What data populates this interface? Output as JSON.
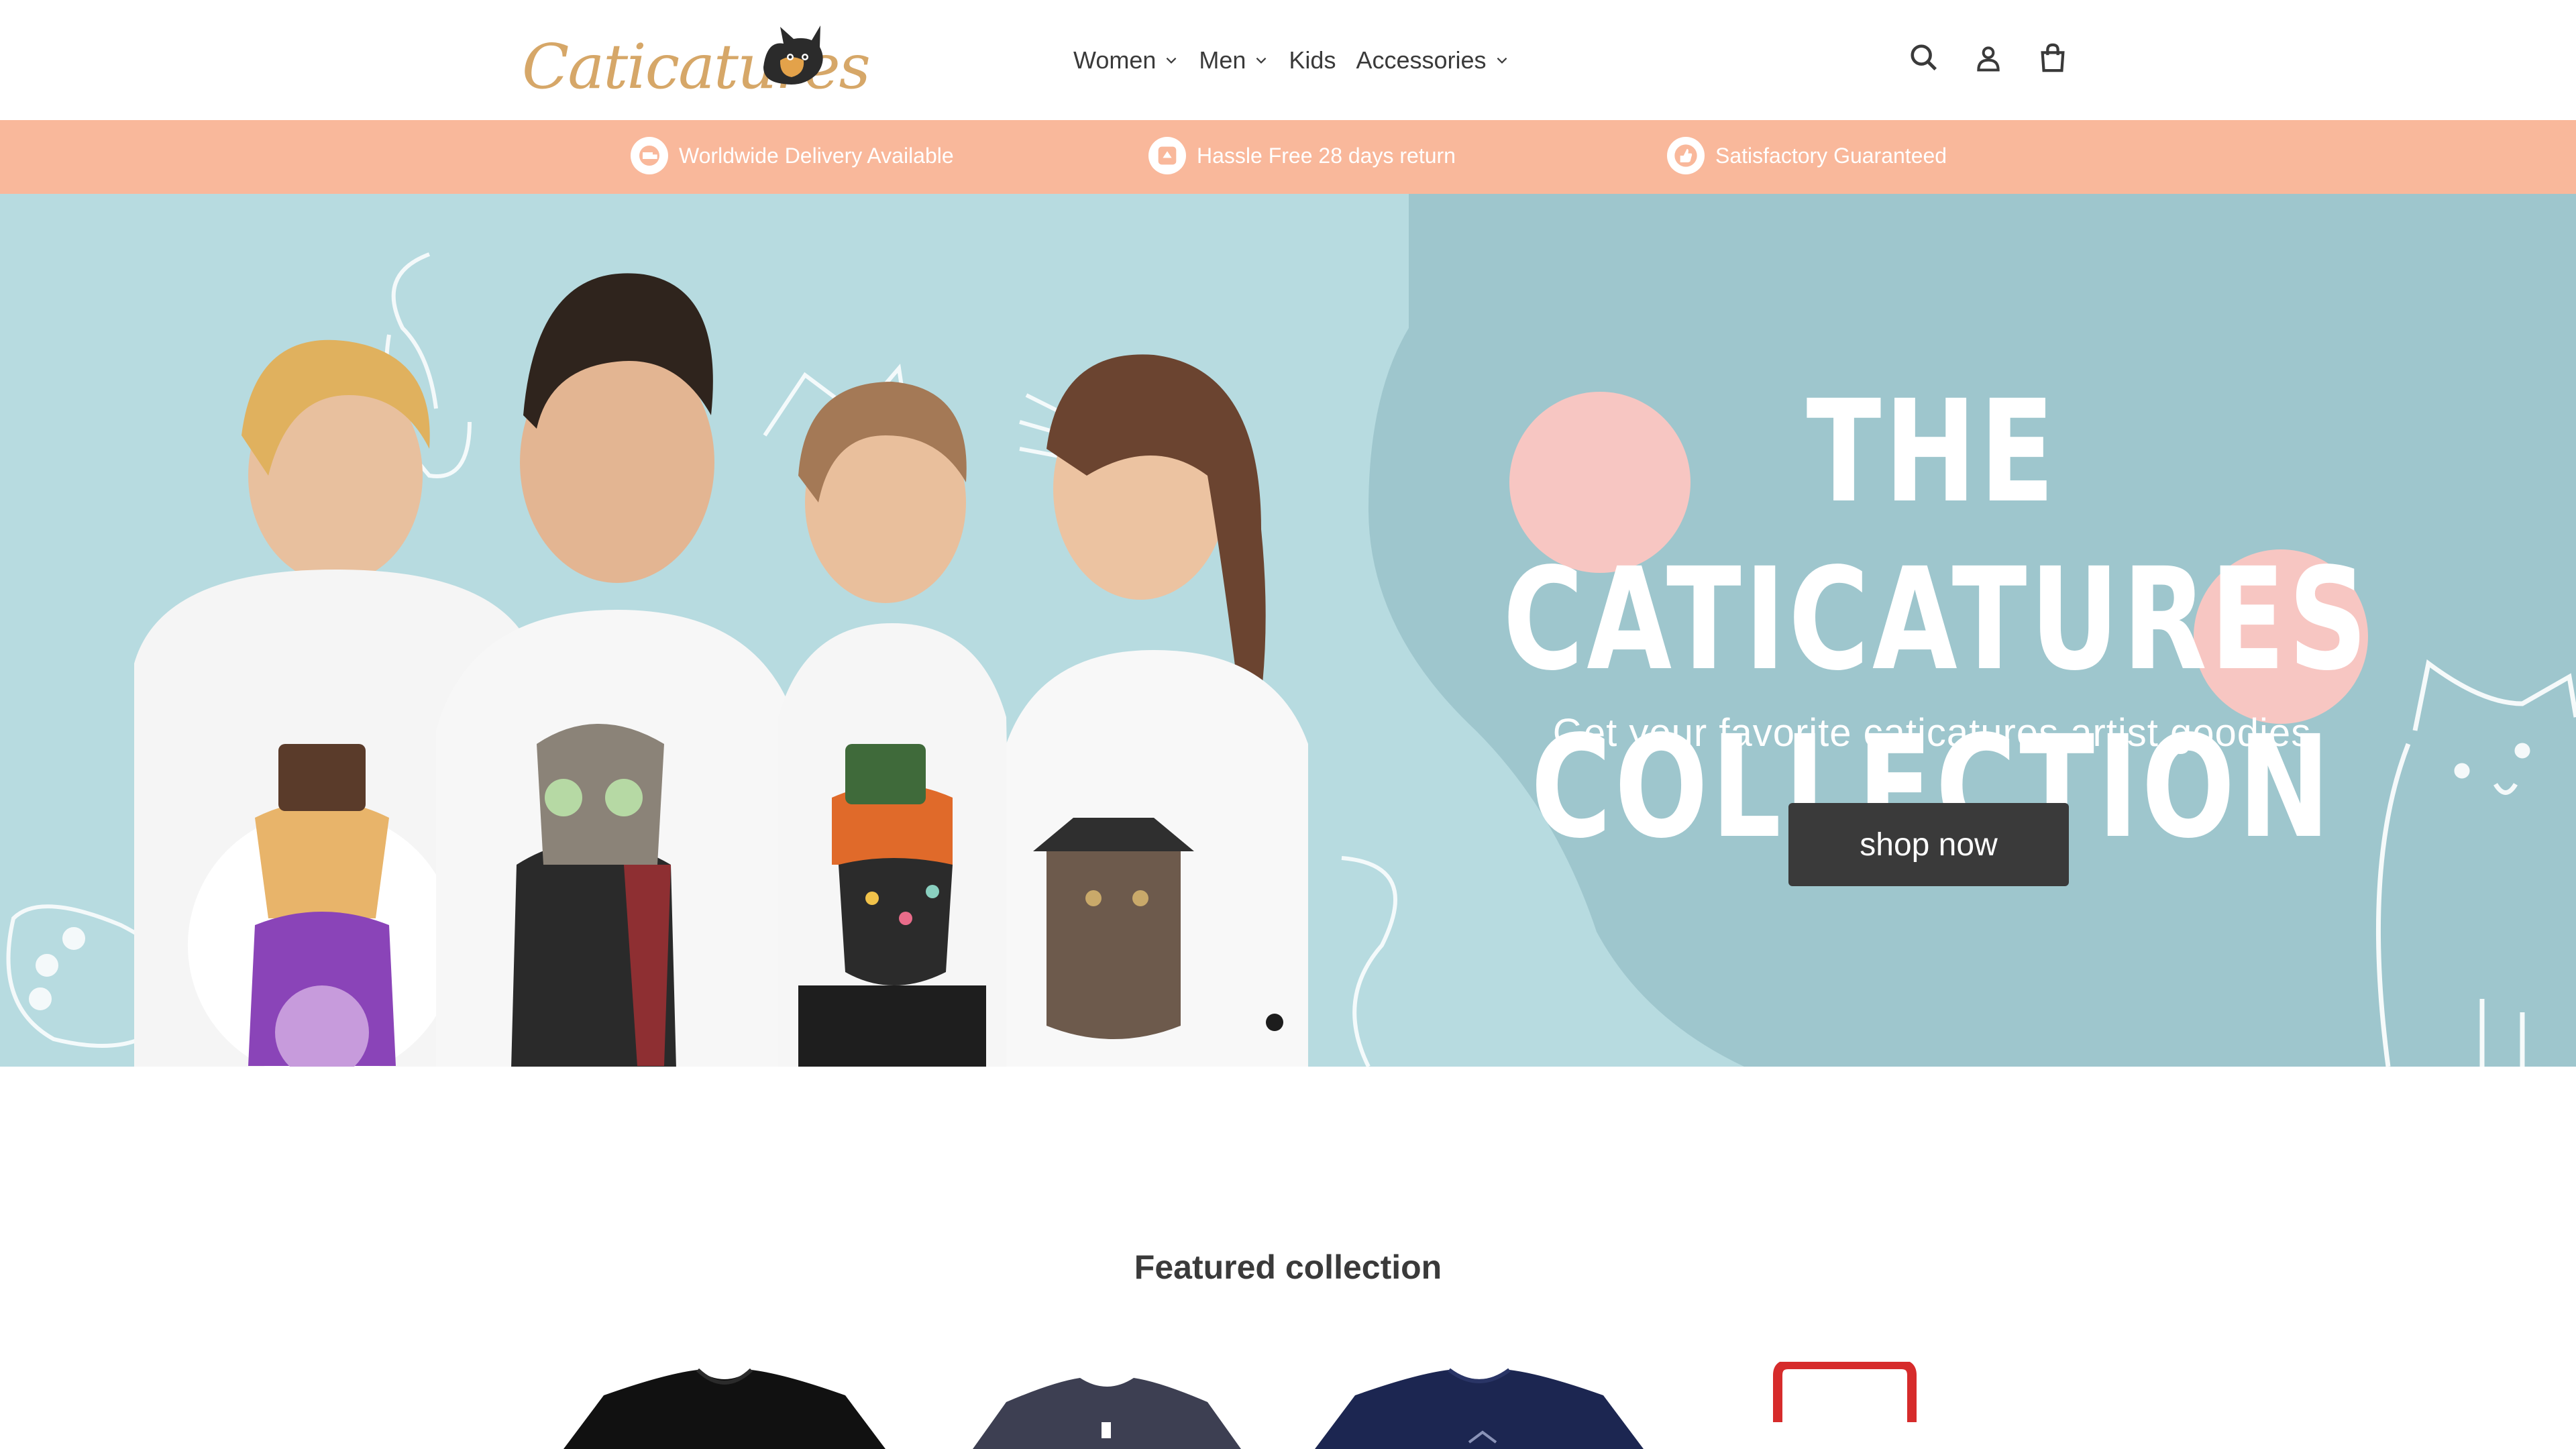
{
  "brand": {
    "name": "Caticatures",
    "accent_color": "#d6a768"
  },
  "nav": {
    "items": [
      {
        "label": "Women",
        "has_dropdown": true
      },
      {
        "label": "Men",
        "has_dropdown": true
      },
      {
        "label": "Kids",
        "has_dropdown": false
      },
      {
        "label": "Accessories",
        "has_dropdown": true
      }
    ]
  },
  "header_icons": [
    "search-icon",
    "account-icon",
    "cart-icon"
  ],
  "announcement": {
    "background": "#f9b89b",
    "items": [
      {
        "icon": "delivery-icon",
        "text": "Worldwide Delivery Available"
      },
      {
        "icon": "return-icon",
        "text": "Hassle Free 28 days return"
      },
      {
        "icon": "thumbs-up-icon",
        "text": "Satisfactory Guaranteed"
      }
    ]
  },
  "hero": {
    "title_line1": "THE CATICATURES",
    "title_line2": "COLLECTION",
    "subtitle": "Get your favorite caticatures artist goodies",
    "button_label": "shop now",
    "background": "#b7dbe0",
    "slide_count": 1,
    "active_slide": 1
  },
  "featured": {
    "title": "Featured collection",
    "products": [
      {
        "type": "t-shirt",
        "color": "#111111"
      },
      {
        "type": "t-shirt",
        "color": "#3d3f52"
      },
      {
        "type": "t-shirt",
        "color": "#1c2651"
      },
      {
        "type": "tote-bag",
        "color": "#d62b2b"
      }
    ]
  }
}
